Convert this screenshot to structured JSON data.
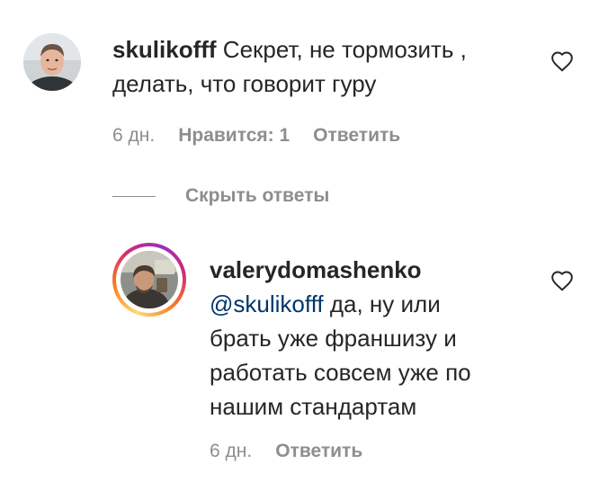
{
  "comments": [
    {
      "username": "skulikofff",
      "text_line1": " Секрет, не тормозить ,",
      "text_line2": "делать, что говорит гуру",
      "time": "6 дн.",
      "likes": "Нравится: 1",
      "reply": "Ответить",
      "avatar": "user-photo-avatar",
      "like_icon": "heart-outline-icon"
    }
  ],
  "hide_replies": {
    "label": "Скрыть ответы"
  },
  "replies": [
    {
      "username": "valerydomashenko",
      "mention": "@skulikofff",
      "text_line1": " да, ну или",
      "text_line2": "брать уже франшизу и",
      "text_line3": "работать совсем уже по",
      "text_line4": "нашим стандартам",
      "time": "6 дн.",
      "reply": "Ответить",
      "avatar": "user-photo-avatar-with-story-ring",
      "like_icon": "heart-outline-icon"
    }
  ],
  "colors": {
    "text": "#262626",
    "secondary": "#8e8e8e",
    "mention": "#00376b"
  }
}
